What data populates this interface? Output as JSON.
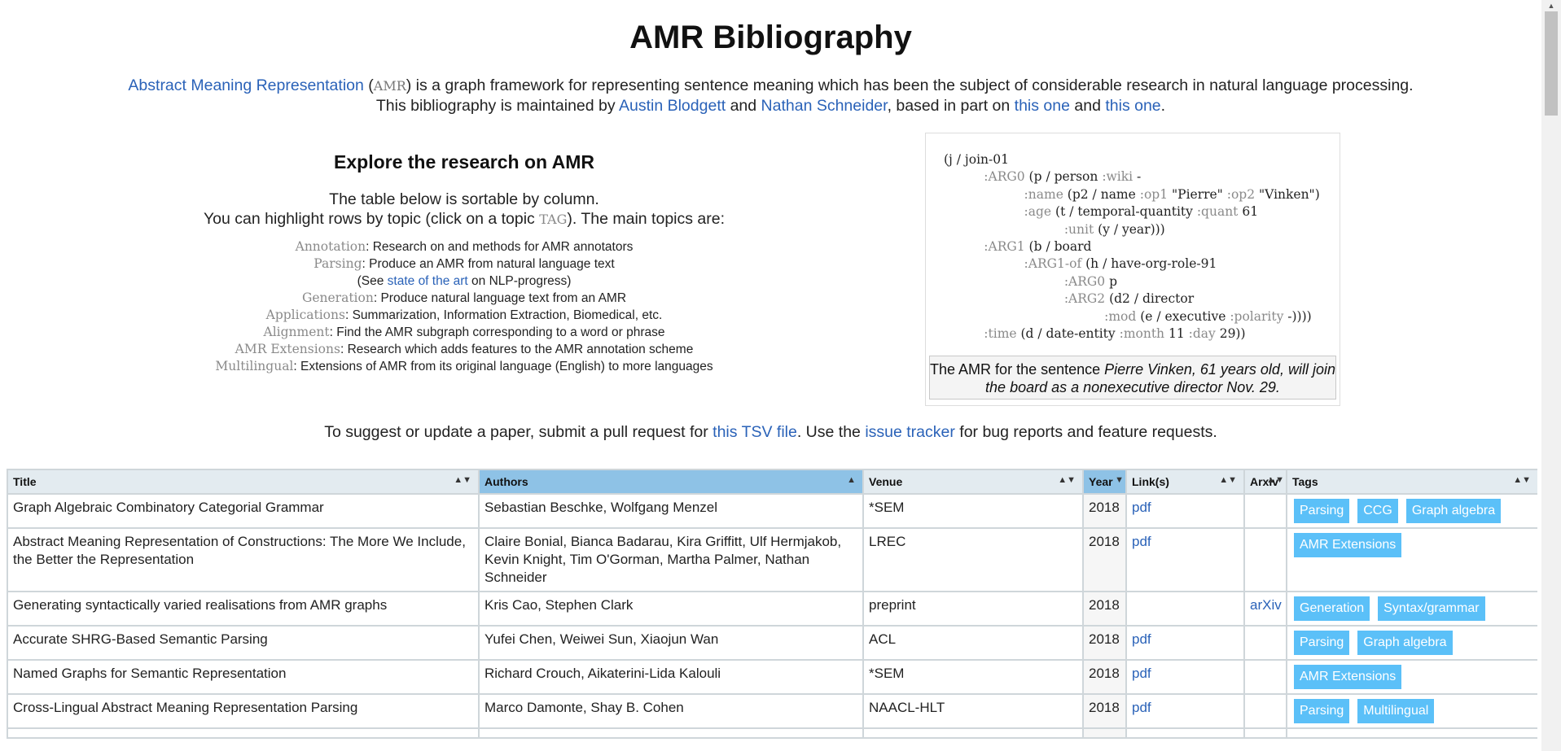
{
  "title": "AMR Bibliography",
  "intro": {
    "amr_link": "Abstract Meaning Representation",
    "open_paren": " (",
    "amr_abbr": "AMR",
    "rest1": ") is a graph framework for representing sentence meaning which has been the subject of considerable research in natural language processing.",
    "maintained": "This bibliography is maintained by ",
    "author1": "Austin Blodgett",
    "and": " and ",
    "author2": "Nathan Schneider",
    "based": ", based in part on ",
    "link1": "this one",
    "and2": " and ",
    "link2": "this one",
    "period": "."
  },
  "explore": {
    "heading": "Explore the research on AMR",
    "line1": "The table below is sortable by column.",
    "line2a": "You can highlight rows by topic (click on a topic ",
    "tag_word": "TAG",
    "line2b": "). The main topics are:",
    "topics": [
      {
        "name": "Annotation",
        "desc": ": Research on and methods for AMR annotators"
      },
      {
        "name": "Parsing",
        "desc": ": Produce an AMR from natural language text"
      },
      {
        "name": "Generation",
        "desc": ": Produce natural language text from an AMR"
      },
      {
        "name": "Applications",
        "desc": ": Summarization, Information Extraction, Biomedical, etc."
      },
      {
        "name": "Alignment",
        "desc": ": Find the AMR subgraph corresponding to a word or phrase"
      },
      {
        "name": "AMR Extensions",
        "desc": ": Research which adds features to the AMR annotation scheme"
      },
      {
        "name": "Multilingual",
        "desc": ": Extensions of AMR from its original language (English) to more languages"
      }
    ],
    "see_prefix": "(See ",
    "see_link": "state of the art",
    "see_suffix": " on NLP-progress)"
  },
  "amr_example": {
    "caption_prefix": "The AMR for the sentence ",
    "caption_sentence": "Pierre Vinken, 61 years old, will join the board as a nonexecutive director Nov. 29."
  },
  "suggest": {
    "prefix": "To suggest or update a paper, submit a pull request for ",
    "tsv_link": "this TSV file",
    "middle": ". Use the ",
    "issue_link": "issue tracker",
    "suffix": " for bug reports and feature requests."
  },
  "table": {
    "columns": [
      "Title",
      "Authors",
      "Venue",
      "Year",
      "Link(s)",
      "Arxiv",
      "Tags"
    ],
    "rows": [
      {
        "title": "Graph Algebraic Combinatory Categorial Grammar",
        "authors": "Sebastian Beschke, Wolfgang Menzel",
        "venue": "*SEM",
        "year": "2018",
        "link": "pdf",
        "arxiv": "",
        "tags": [
          "Parsing",
          "CCG",
          "Graph algebra"
        ]
      },
      {
        "title": "Abstract Meaning Representation of Constructions: The More We Include, the Better the Representation",
        "authors": "Claire Bonial, Bianca Badarau, Kira Griffitt, Ulf Hermjakob, Kevin Knight, Tim O'Gorman, Martha Palmer, Nathan Schneider",
        "venue": "LREC",
        "year": "2018",
        "link": "pdf",
        "arxiv": "",
        "tags": [
          "AMR Extensions"
        ]
      },
      {
        "title": "Generating syntactically varied realisations from AMR graphs",
        "authors": "Kris Cao, Stephen Clark",
        "venue": "preprint",
        "year": "2018",
        "link": "",
        "arxiv": "arXiv",
        "tags": [
          "Generation",
          "Syntax/grammar"
        ]
      },
      {
        "title": "Accurate SHRG-Based Semantic Parsing",
        "authors": "Yufei Chen, Weiwei Sun, Xiaojun Wan",
        "venue": "ACL",
        "year": "2018",
        "link": "pdf",
        "arxiv": "",
        "tags": [
          "Parsing",
          "Graph algebra"
        ]
      },
      {
        "title": "Named Graphs for Semantic Representation",
        "authors": "Richard Crouch, Aikaterini-Lida Kalouli",
        "venue": "*SEM",
        "year": "2018",
        "link": "pdf",
        "arxiv": "",
        "tags": [
          "AMR Extensions"
        ]
      },
      {
        "title": "Cross-Lingual Abstract Meaning Representation Parsing",
        "authors": "Marco Damonte, Shay B. Cohen",
        "venue": "NAACL-HLT",
        "year": "2018",
        "link": "pdf",
        "arxiv": "",
        "tags": [
          "Parsing",
          "Multilingual"
        ]
      },
      {
        "title": "",
        "authors": "",
        "venue": "",
        "year": "",
        "link": "",
        "arxiv": "",
        "tags": []
      }
    ]
  },
  "colors": {
    "link": "#2a62b8",
    "tag_bg": "#5bc0f8",
    "sorted_header": "#8ec2e6",
    "header_bg": "#e3ebf0"
  }
}
